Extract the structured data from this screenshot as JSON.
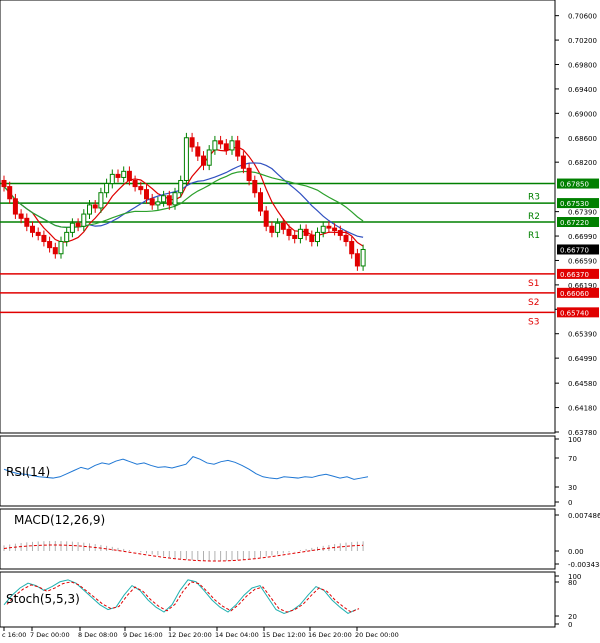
{
  "main": {
    "y_min": 0.6378,
    "y_max": 0.7066,
    "y_ticks": [
      "0.70600",
      "0.70200",
      "0.69800",
      "0.69400",
      "0.69000",
      "0.68600",
      "0.68200",
      "0.67390",
      "0.66990",
      "0.66590",
      "0.66190",
      "0.65790",
      "0.65390",
      "0.64990",
      "0.64580",
      "0.64180",
      "0.63780"
    ],
    "current_price": "0.66770",
    "levels": [
      {
        "name": "R3",
        "value": 0.6785,
        "label": "0.67850",
        "color": "#008000"
      },
      {
        "name": "R2",
        "value": 0.6753,
        "label": "0.67530",
        "color": "#008000"
      },
      {
        "name": "R1",
        "value": 0.6722,
        "label": "0.67220",
        "color": "#008000"
      },
      {
        "name": "S1",
        "value": 0.6637,
        "label": "0.66370",
        "color": "#e00000"
      },
      {
        "name": "S2",
        "value": 0.6606,
        "label": "0.66060",
        "color": "#e00000"
      },
      {
        "name": "S3",
        "value": 0.6574,
        "label": "0.65740",
        "color": "#e00000"
      }
    ],
    "colors": {
      "up": "#008000",
      "down": "#e00000",
      "ma_fast": "#e00000",
      "ma_mid": "#3050c0",
      "ma_slow": "#2ca02c"
    }
  },
  "rsi": {
    "label": "RSI(14)",
    "ticks": [
      "100",
      "70",
      "30",
      "0"
    ]
  },
  "macd": {
    "label": "MACD(12,26,9)",
    "ticks": [
      "0.007486",
      "0.00",
      "-0.003434"
    ]
  },
  "stoch": {
    "label": "Stoch(5,5,3)",
    "ticks": [
      "100",
      "80",
      "20",
      "0"
    ]
  },
  "time_axis": [
    "c 16:00",
    "7 Dec 00:00",
    "8 Dec 08:00",
    "9 Dec 16:00",
    "12 Dec 20:00",
    "14 Dec 04:00",
    "15 Dec 12:00",
    "16 Dec 20:00",
    "20 Dec 00:00"
  ]
}
